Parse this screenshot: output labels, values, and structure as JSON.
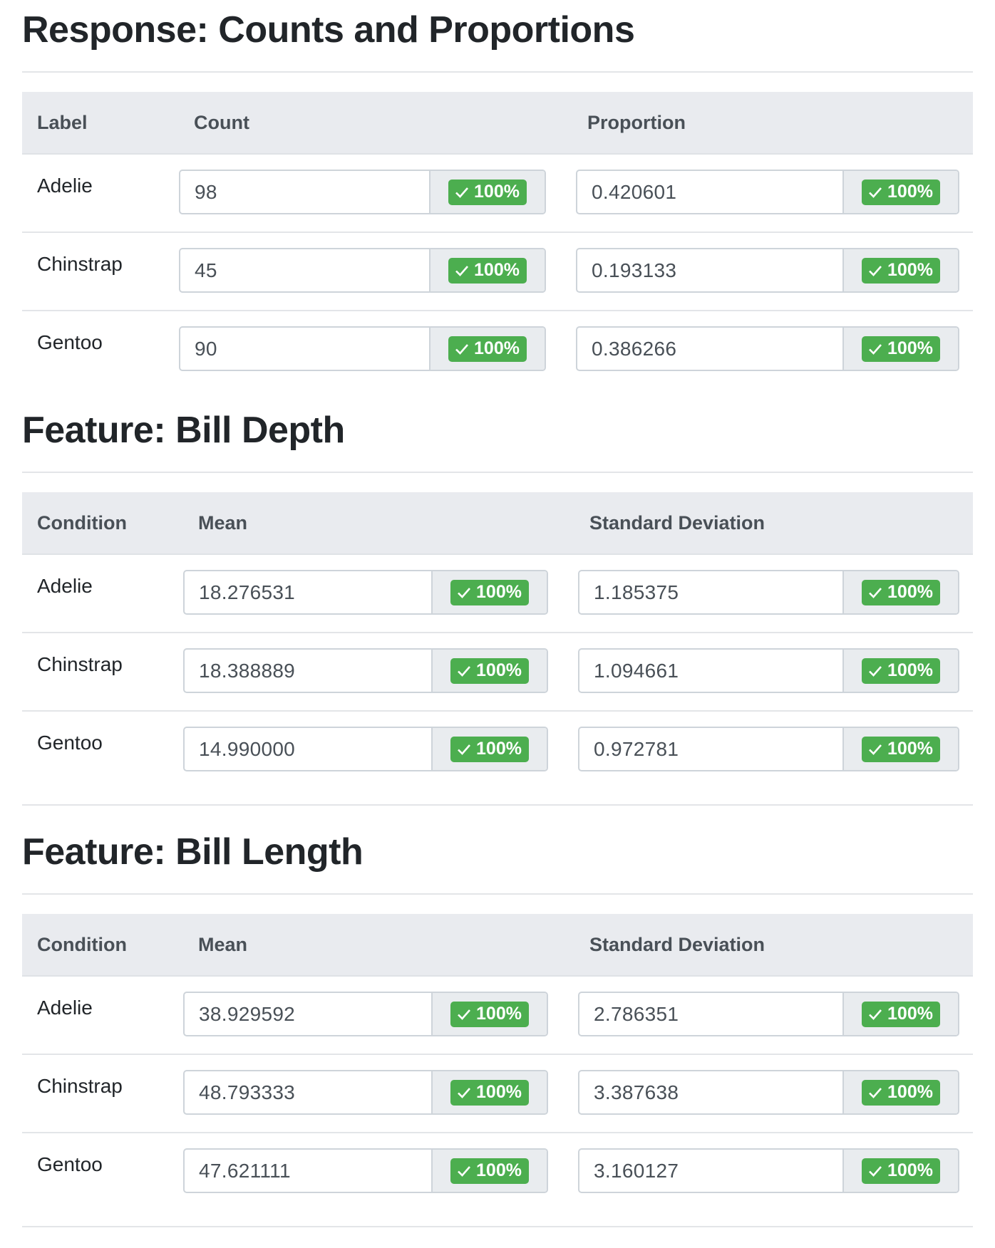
{
  "sections": [
    {
      "title": "Response: Counts and Proportions",
      "columns": [
        "Label",
        "Count",
        "Proportion"
      ],
      "rows": [
        {
          "label": "Adelie",
          "a": "98",
          "a_badge": "100%",
          "b": "0.420601",
          "b_badge": "100%"
        },
        {
          "label": "Chinstrap",
          "a": "45",
          "a_badge": "100%",
          "b": "0.193133",
          "b_badge": "100%"
        },
        {
          "label": "Gentoo",
          "a": "90",
          "a_badge": "100%",
          "b": "0.386266",
          "b_badge": "100%"
        }
      ]
    },
    {
      "title": "Feature: Bill Depth",
      "columns": [
        "Condition",
        "Mean",
        "Standard Deviation"
      ],
      "rows": [
        {
          "label": "Adelie",
          "a": "18.276531",
          "a_badge": "100%",
          "b": "1.185375",
          "b_badge": "100%"
        },
        {
          "label": "Chinstrap",
          "a": "18.388889",
          "a_badge": "100%",
          "b": "1.094661",
          "b_badge": "100%"
        },
        {
          "label": "Gentoo",
          "a": "14.990000",
          "a_badge": "100%",
          "b": "0.972781",
          "b_badge": "100%"
        }
      ]
    },
    {
      "title": "Feature: Bill Length",
      "columns": [
        "Condition",
        "Mean",
        "Standard Deviation"
      ],
      "rows": [
        {
          "label": "Adelie",
          "a": "38.929592",
          "a_badge": "100%",
          "b": "2.786351",
          "b_badge": "100%"
        },
        {
          "label": "Chinstrap",
          "a": "48.793333",
          "a_badge": "100%",
          "b": "3.387638",
          "b_badge": "100%"
        },
        {
          "label": "Gentoo",
          "a": "47.621111",
          "a_badge": "100%",
          "b": "3.160127",
          "b_badge": "100%"
        }
      ]
    }
  ],
  "icons": {
    "badge_icon": "check-icon"
  },
  "colors": {
    "badge_bg": "#4cae4f",
    "header_bg": "#e9ebef"
  }
}
